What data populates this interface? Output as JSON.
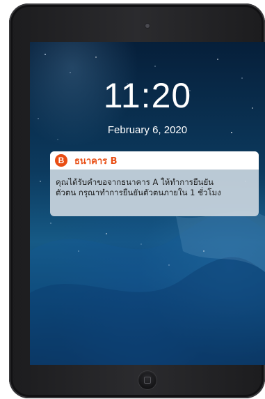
{
  "lock_screen": {
    "time": "11:20",
    "date": "February 6, 2020"
  },
  "notification": {
    "app_icon_letter": "B",
    "app_name": "ธนาคาร B",
    "message_line1": "คุณได้รับคำขอจากธนาคาร A ให้ทำการยืนยัน",
    "message_line2": "ตัวตน กรุณาทำการยืนยันตัวตนภายใน 1 ชั่วโมง",
    "accent_color": "#e94e14"
  },
  "device": {
    "camera_icon": "camera-icon",
    "home_button_icon": "home-button-icon"
  }
}
